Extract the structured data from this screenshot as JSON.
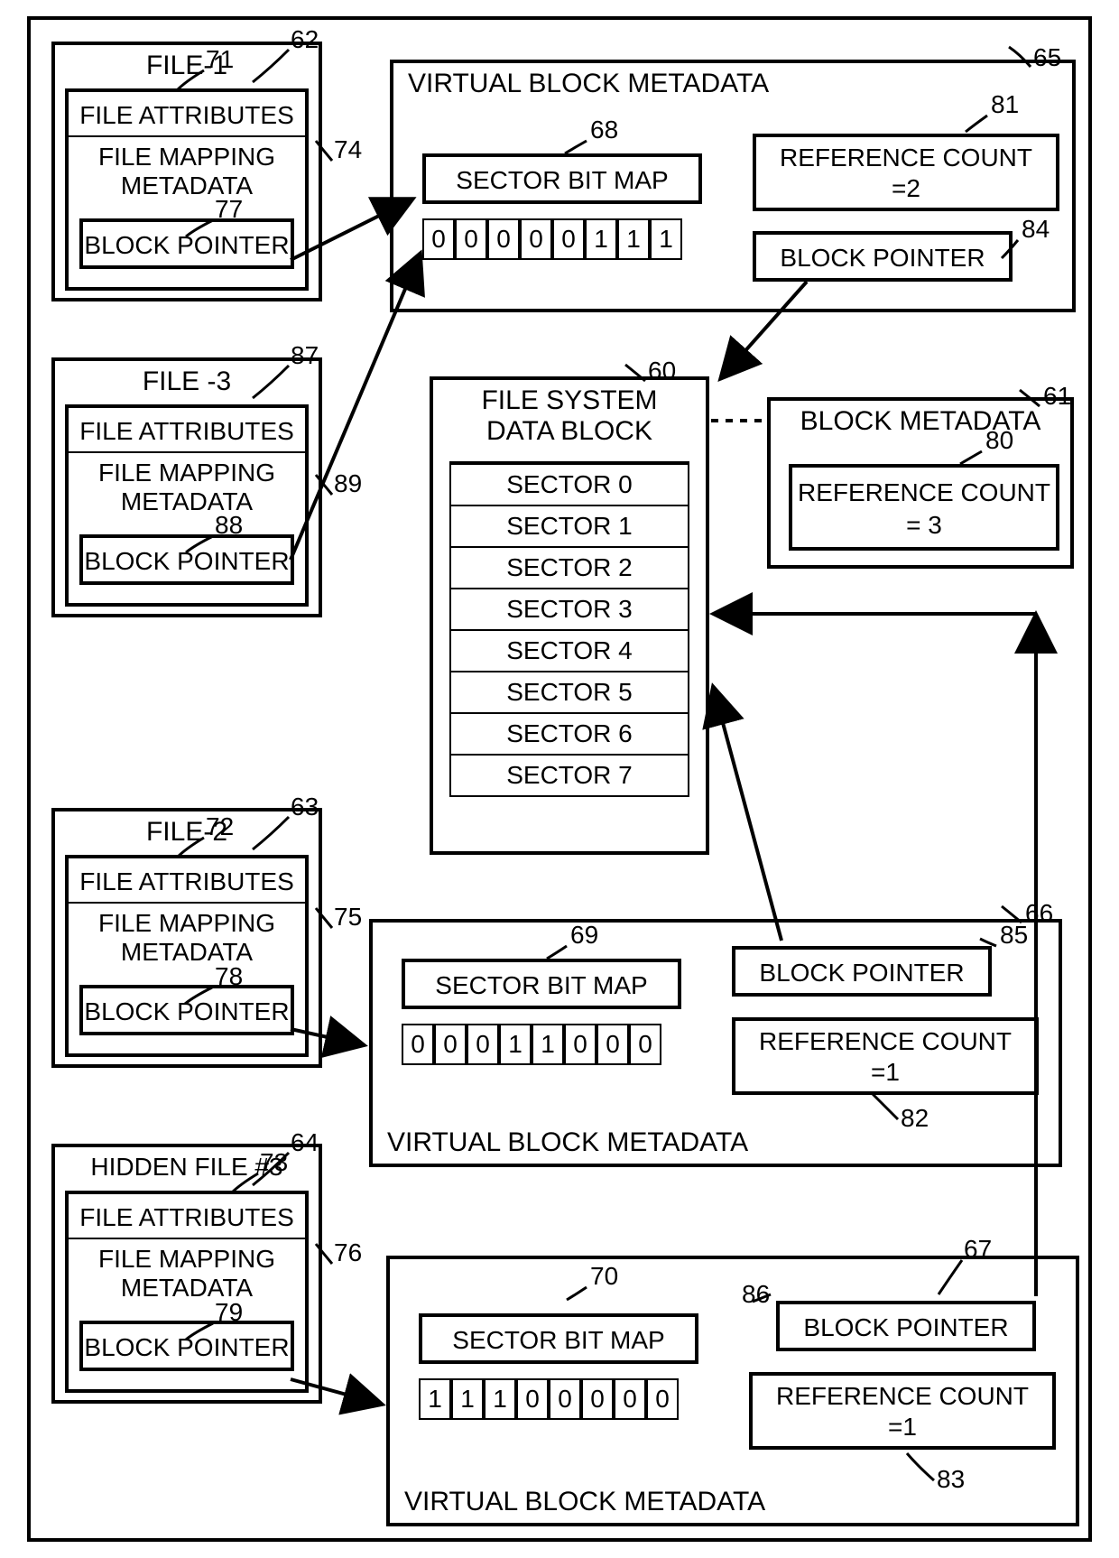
{
  "outer_ref": "",
  "files": {
    "file1": {
      "ref": "62",
      "title": "FILE-1",
      "attr_ref": "71",
      "attr": "FILE ATTRIBUTES",
      "map": "FILE MAPPING METADATA",
      "map_ref": "74",
      "bp": "BLOCK POINTER",
      "bp_ref": "77"
    },
    "file3": {
      "ref": "87",
      "title": "FILE -3",
      "attr": "FILE ATTRIBUTES",
      "map": "FILE MAPPING METADATA",
      "map_ref": "89",
      "bp": "BLOCK POINTER",
      "bp_ref": "88"
    },
    "file2": {
      "ref": "63",
      "title": "FILE-2",
      "attr_ref": "72",
      "attr": "FILE ATTRIBUTES",
      "map": "FILE MAPPING METADATA",
      "map_ref": "75",
      "bp": "BLOCK POINTER",
      "bp_ref": "78"
    },
    "file4": {
      "ref": "64",
      "title": "HIDDEN FILE #3",
      "attr_ref": "73",
      "attr": "FILE ATTRIBUTES",
      "map": "FILE MAPPING METADATA",
      "map_ref": "76",
      "bp": "BLOCK POINTER",
      "bp_ref": "79"
    }
  },
  "vbm1": {
    "ref": "65",
    "title": "VIRTUAL BLOCK METADATA",
    "sbm_ref": "68",
    "sbm": "SECTOR BIT MAP",
    "bits": [
      "0",
      "0",
      "0",
      "0",
      "0",
      "1",
      "1",
      "1"
    ],
    "rc_ref": "81",
    "rc_line1": "REFERENCE COUNT",
    "rc_line2": "=2",
    "bp": "BLOCK POINTER",
    "bp_ref": "84"
  },
  "vbm2": {
    "ref": "66",
    "title": "VIRTUAL BLOCK METADATA",
    "sbm_ref": "69",
    "sbm": "SECTOR BIT MAP",
    "bits": [
      "0",
      "0",
      "0",
      "1",
      "1",
      "0",
      "0",
      "0"
    ],
    "rc_ref": "82",
    "rc_line1": "REFERENCE COUNT",
    "rc_line2": "=1",
    "bp": "BLOCK POINTER",
    "bp_ref": "85"
  },
  "vbm3": {
    "ref": "67",
    "title": "VIRTUAL BLOCK METADATA",
    "sbm_ref": "70",
    "sbm": "SECTOR BIT MAP",
    "bits": [
      "1",
      "1",
      "1",
      "0",
      "0",
      "0",
      "0",
      "0"
    ],
    "rc_ref": "83",
    "rc_line1": "REFERENCE COUNT",
    "rc_line2": "=1",
    "bp": "BLOCK POINTER",
    "bp_ref": "86"
  },
  "fsdb": {
    "ref": "60",
    "title1": "FILE SYSTEM",
    "title2": "DATA BLOCK",
    "sectors": [
      "SECTOR 0",
      "SECTOR 1",
      "SECTOR 2",
      "SECTOR 3",
      "SECTOR 4",
      "SECTOR 5",
      "SECTOR 6",
      "SECTOR 7"
    ]
  },
  "bm": {
    "ref": "61",
    "title": "BLOCK METADATA",
    "rc_ref": "80",
    "rc_line1": "REFERENCE COUNT",
    "rc_line2": "= 3"
  }
}
